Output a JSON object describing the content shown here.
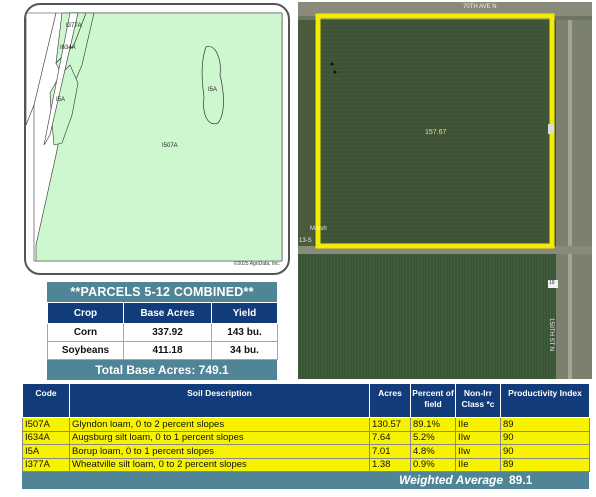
{
  "soil_map": {
    "labels": [
      "I377A",
      "I634A",
      "I5A",
      "I5A",
      "I507A"
    ],
    "copyright": "©2025 AgriData, Inc."
  },
  "parcels": {
    "title": "**PARCELS 5-12 COMBINED**",
    "headers": [
      "Crop",
      "Base Acres",
      "Yield"
    ],
    "rows": [
      {
        "crop": "Corn",
        "base_acres": "337.92",
        "yield": "143 bu."
      },
      {
        "crop": "Soybeans",
        "base_acres": "411.18",
        "yield": "34 bu."
      }
    ],
    "total_label": "Total Base Acres:",
    "total_value": "749.1"
  },
  "aerial": {
    "field_acres": "157.67",
    "road_top": "70TH AVE N",
    "road_side": "150TH ST N",
    "road_left": "13-S",
    "route": "19",
    "marker": "Marsh"
  },
  "soil_table": {
    "headers": {
      "code": "Code",
      "description": "Soil Description",
      "acres": "Acres",
      "percent": "Percent of field",
      "class": "Non-Irr Class *c",
      "productivity": "Productivity Index"
    },
    "rows": [
      {
        "code": "I507A",
        "description": "Glyndon loam, 0 to 2 percent slopes",
        "acres": "130.57",
        "percent": "89.1%",
        "class": "IIe",
        "productivity": "89"
      },
      {
        "code": "I634A",
        "description": "Augsburg silt loam, 0 to 1 percent slopes",
        "acres": "7.64",
        "percent": "5.2%",
        "class": "IIw",
        "productivity": "90"
      },
      {
        "code": "I5A",
        "description": "Borup loam, 0 to 1 percent slopes",
        "acres": "7.01",
        "percent": "4.8%",
        "class": "IIw",
        "productivity": "90"
      },
      {
        "code": "I377A",
        "description": "Wheatville silt loam, 0 to 2 percent slopes",
        "acres": "1.38",
        "percent": "0.9%",
        "class": "IIe",
        "productivity": "89"
      }
    ],
    "weighted_label": "Weighted Average",
    "weighted_value": "89.1"
  },
  "colors": {
    "map_fill": "#cdf7cf",
    "boundary": "#f5eb00",
    "header_blue": "#123b7a",
    "teal": "#4f8596",
    "row_yellow": "#f6f200"
  }
}
